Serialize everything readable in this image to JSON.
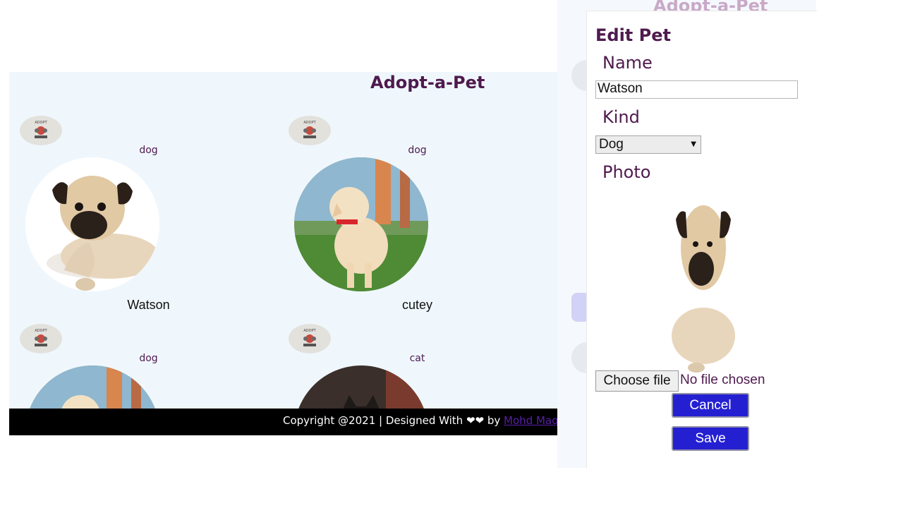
{
  "page": {
    "title": "Adopt-a-Pet"
  },
  "pets": [
    {
      "kind": "dog",
      "name": "Watson",
      "photo": "pug-icon"
    },
    {
      "kind": "dog",
      "name": "cutey",
      "photo": "golden-puppy-icon"
    },
    {
      "kind": "dog",
      "name": "",
      "photo": "golden-puppy-icon"
    },
    {
      "kind": "cat",
      "name": "",
      "photo": "cat-icon"
    }
  ],
  "footer": {
    "text": "Copyright @2021 | Designed With ❤❤ by ",
    "link": "Mohd Maqbool"
  },
  "modal": {
    "title": "Edit Pet",
    "name_label": "Name",
    "name_value": "Watson",
    "kind_label": "Kind",
    "kind_value": "Dog",
    "photo_label": "Photo",
    "file_button": "Choose file",
    "file_status": "No file chosen",
    "cancel": "Cancel",
    "save": "Save"
  },
  "colors": {
    "accent": "#4f1a4e",
    "button": "#2420d2",
    "page_bg": "#eff7fd",
    "footer_bg": "#000000"
  }
}
